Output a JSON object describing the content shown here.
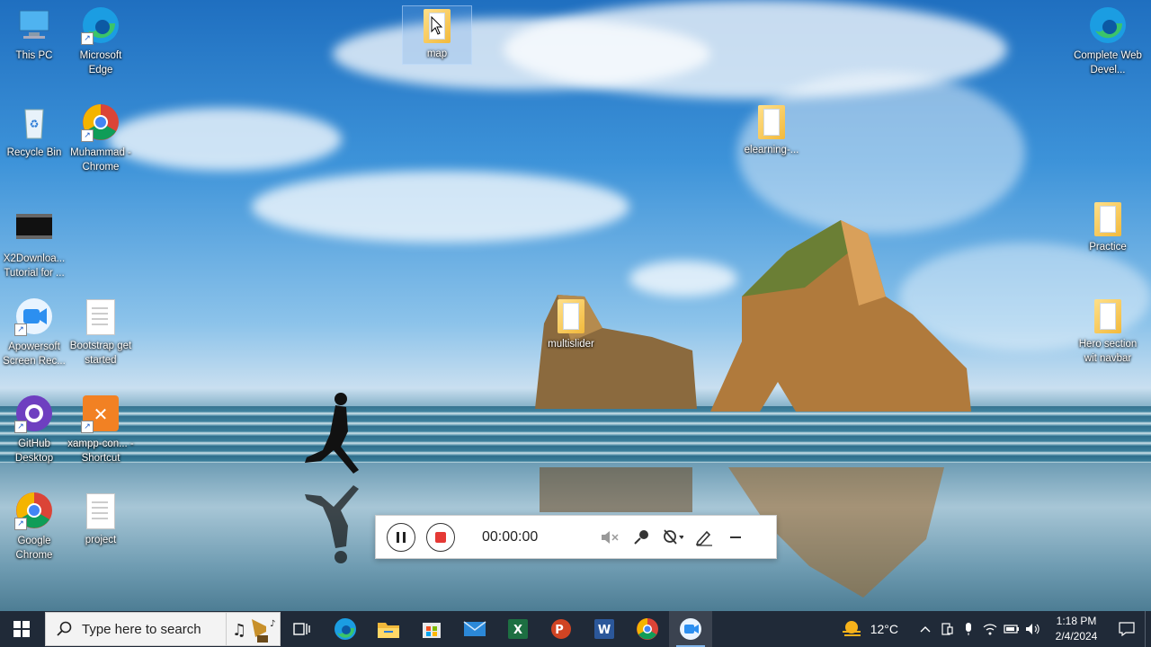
{
  "desktop": {
    "icons": {
      "this_pc": "This PC",
      "edge": "Microsoft Edge",
      "recycle": "Recycle Bin",
      "chrome_profile": "Muhammad - Chrome",
      "x2download": "X2Downloa... Tutorial for ...",
      "apowersoft": "Apowersoft Screen Rec...",
      "bootstrap": "Bootstrap get started",
      "github": "GitHub Desktop",
      "xampp": "xampp-con... - Shortcut",
      "google_chrome": "Google Chrome",
      "project": "project",
      "map": "map",
      "elearning": "elearning-...",
      "multislider": "multislider",
      "complete_web": "Complete Web Devel...",
      "practice": "Practice",
      "hero_section": "Hero section wit navbar"
    }
  },
  "recorder": {
    "time": "00:00:00",
    "controls": [
      "pause",
      "stop",
      "speaker-muted",
      "microphone",
      "webcam-off",
      "pen",
      "minimize"
    ]
  },
  "taskbar": {
    "search_placeholder": "Type here to search",
    "apps": [
      "task-view",
      "edge",
      "file-explorer",
      "microsoft-store",
      "mail",
      "excel",
      "powerpoint",
      "word",
      "chrome",
      "apowersoft"
    ],
    "weather_temp": "12°C",
    "time": "1:18 PM",
    "date": "2/4/2024"
  },
  "colors": {
    "taskbar_bg": "#202a38",
    "record_red": "#e53935",
    "folder_yellow": "#f2b93b"
  }
}
